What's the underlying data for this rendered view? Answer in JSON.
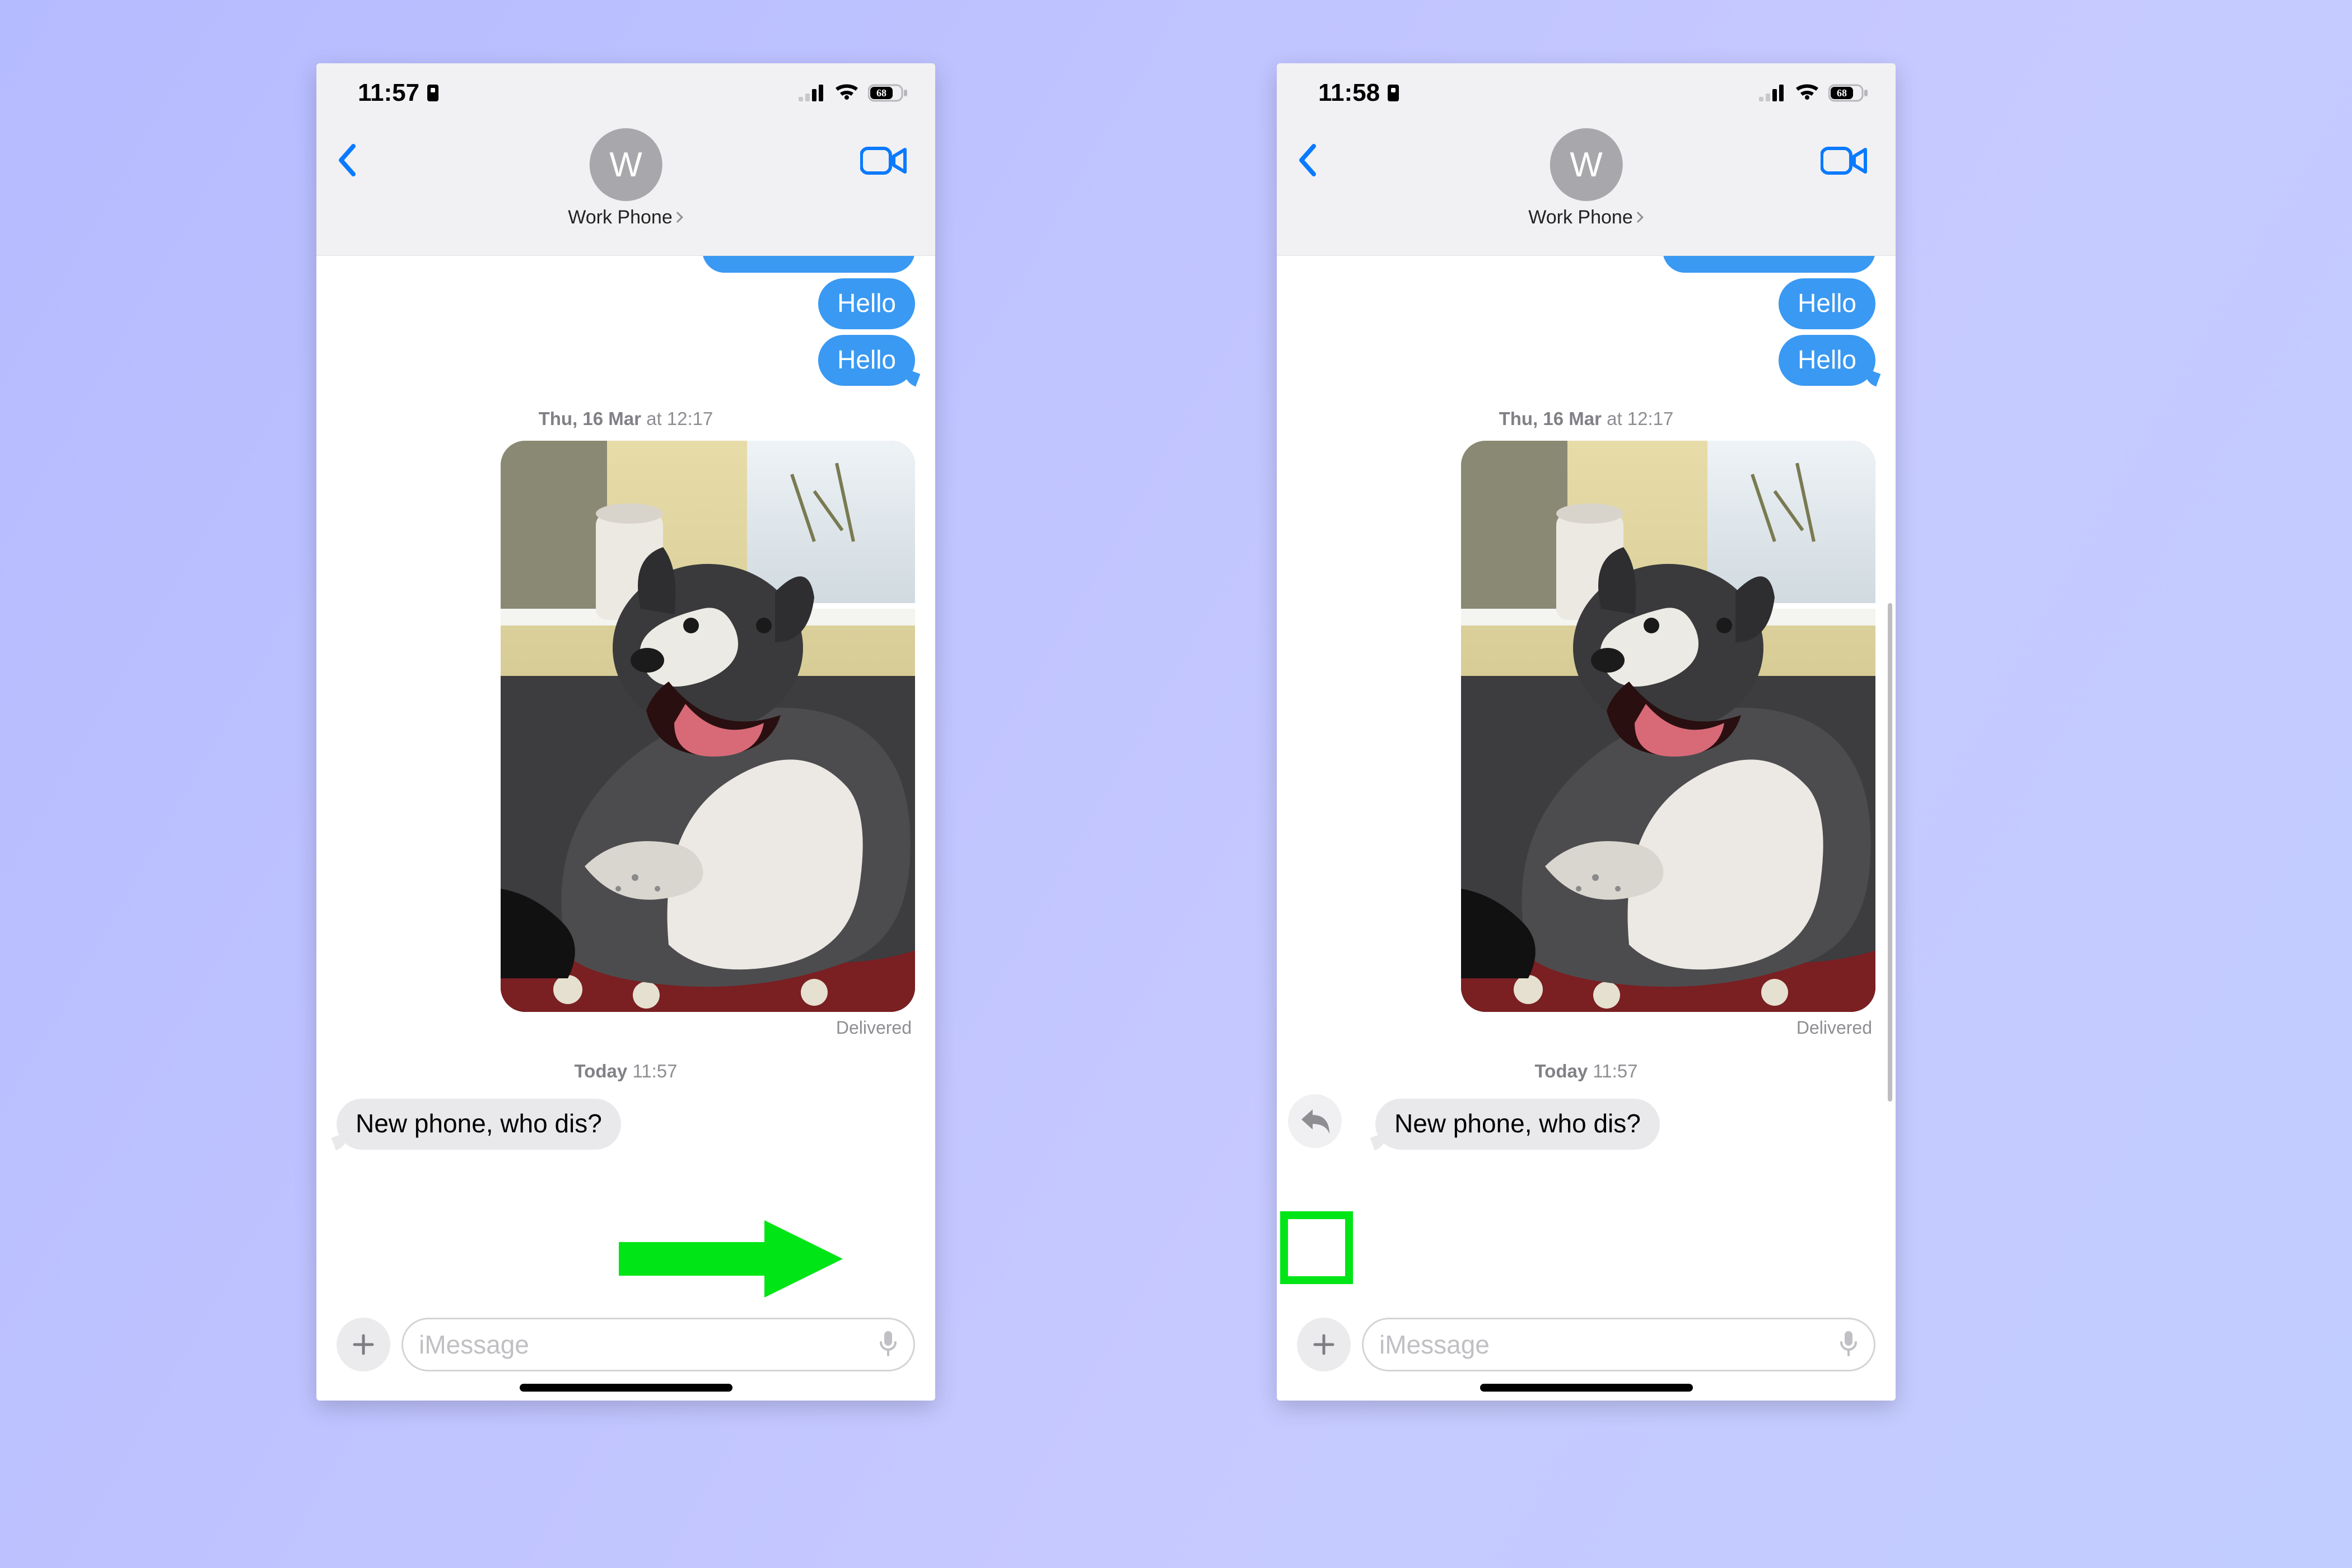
{
  "colors": {
    "ios_blue": "#0a7aff",
    "bubble_blue": "#3a99f2",
    "bubble_grey": "#e9e9eb",
    "annotate_green": "#00e516"
  },
  "left": {
    "status": {
      "time": "11:57",
      "battery": "68"
    },
    "header": {
      "contact_initial": "W",
      "contact_name": "Work Phone"
    },
    "thread": {
      "msg_out_1": "Hello",
      "msg_out_2": "Hello",
      "ts1_day": "Thu, 16 Mar",
      "ts1_time": " at 12:17",
      "delivered": "Delivered",
      "ts2_day": "Today",
      "ts2_time": " 11:57",
      "msg_in_1": "New phone, who dis?"
    },
    "compose": {
      "placeholder": "iMessage"
    }
  },
  "right": {
    "status": {
      "time": "11:58",
      "battery": "68"
    },
    "header": {
      "contact_initial": "W",
      "contact_name": "Work Phone"
    },
    "thread": {
      "msg_out_1": "Hello",
      "msg_out_2": "Hello",
      "ts1_day": "Thu, 16 Mar",
      "ts1_time": " at 12:17",
      "delivered": "Delivered",
      "ts2_day": "Today",
      "ts2_time": " 11:57",
      "msg_in_1": "New phone, who dis?"
    },
    "compose": {
      "placeholder": "iMessage"
    }
  }
}
